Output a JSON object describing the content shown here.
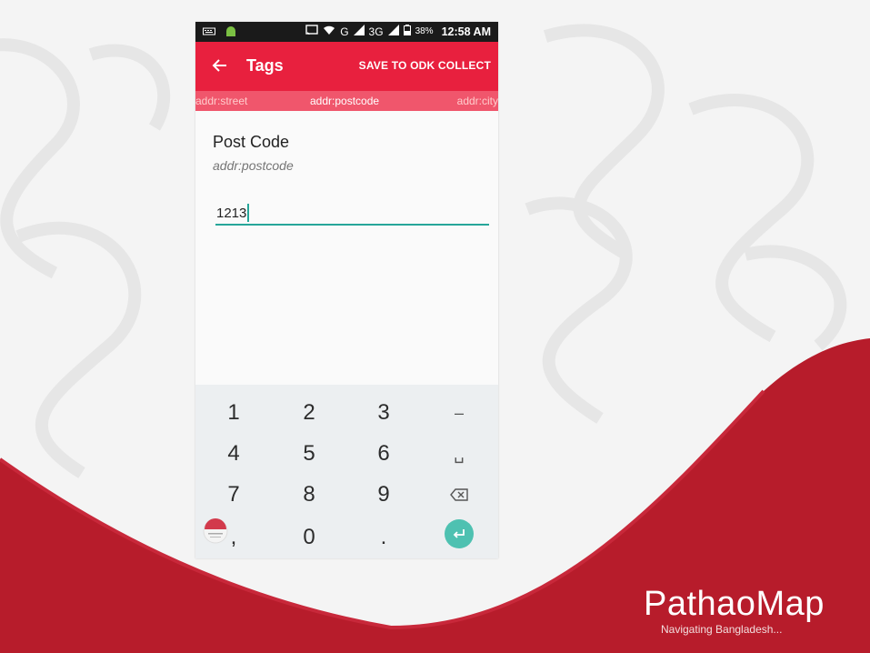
{
  "status_bar": {
    "battery_percent": "38%",
    "time": "12:58 AM",
    "network_g": "G",
    "network_3g": "3G"
  },
  "app_bar": {
    "title": "Tags",
    "save_label": "SAVE TO ODK COLLECT"
  },
  "tabs": {
    "prev": "addr:street",
    "active": "addr:postcode",
    "next": "addr:city"
  },
  "field": {
    "label": "Post Code",
    "key": "addr:postcode",
    "value": "1213"
  },
  "keyboard": {
    "row1": [
      "1",
      "2",
      "3",
      "–"
    ],
    "row2": [
      "4",
      "5",
      "6",
      "␣"
    ],
    "row3": [
      "7",
      "8",
      "9"
    ],
    "row4": [
      ",",
      "0",
      "."
    ]
  },
  "branding": {
    "name": "PathaoMap",
    "tagline": "Navigating Bangladesh..."
  },
  "colors": {
    "app_bar": "#e8203e",
    "tab_strip": "#f0566c",
    "accent": "#26a699",
    "brand_red": "#b71c2b"
  }
}
